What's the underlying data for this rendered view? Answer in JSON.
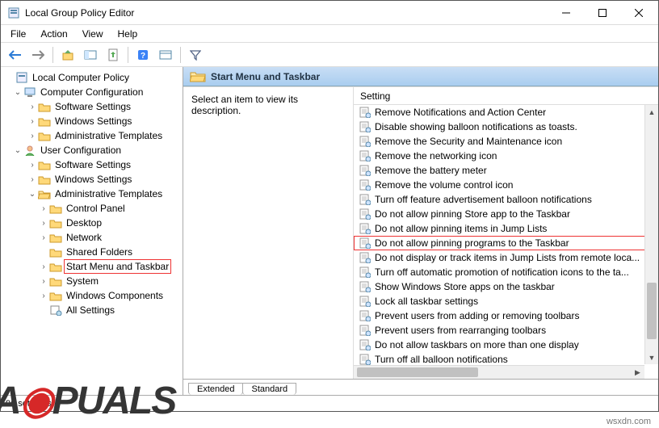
{
  "window": {
    "title": "Local Group Policy Editor"
  },
  "menu": {
    "file": "File",
    "action": "Action",
    "view": "View",
    "help": "Help"
  },
  "tree": {
    "root": "Local Computer Policy",
    "cc": "Computer Configuration",
    "cc_sw": "Software Settings",
    "cc_ws": "Windows Settings",
    "cc_at": "Administrative Templates",
    "uc": "User Configuration",
    "uc_sw": "Software Settings",
    "uc_ws": "Windows Settings",
    "uc_at": "Administrative Templates",
    "cp": "Control Panel",
    "dk": "Desktop",
    "nw": "Network",
    "sf": "Shared Folders",
    "sm": "Start Menu and Taskbar",
    "sy": "System",
    "wc": "Windows Components",
    "as": "All Settings"
  },
  "header": {
    "folder": "Start Menu and Taskbar"
  },
  "desc": {
    "prompt": "Select an item to view its description."
  },
  "list": {
    "col": "Setting",
    "items": [
      "Remove Notifications and Action Center",
      "Disable showing balloon notifications as toasts.",
      "Remove the Security and Maintenance icon",
      "Remove the networking icon",
      "Remove the battery meter",
      "Remove the volume control icon",
      "Turn off feature advertisement balloon notifications",
      "Do not allow pinning Store app to the Taskbar",
      "Do not allow pinning items in Jump Lists",
      "Do not allow pinning programs to the Taskbar",
      "Do not display or track items in Jump Lists from remote loca...",
      "Turn off automatic promotion of notification icons to the ta...",
      "Show Windows Store apps on the taskbar",
      "Lock all taskbar settings",
      "Prevent users from adding or removing toolbars",
      "Prevent users from rearranging toolbars",
      "Do not allow taskbars on more than one display",
      "Turn off all balloon notifications"
    ],
    "highlighted_index": 9
  },
  "tabs": {
    "extended": "Extended",
    "standard": "Standard"
  },
  "status": {
    "text": "96 setting(s)"
  },
  "watermark": "wsxdn.com"
}
